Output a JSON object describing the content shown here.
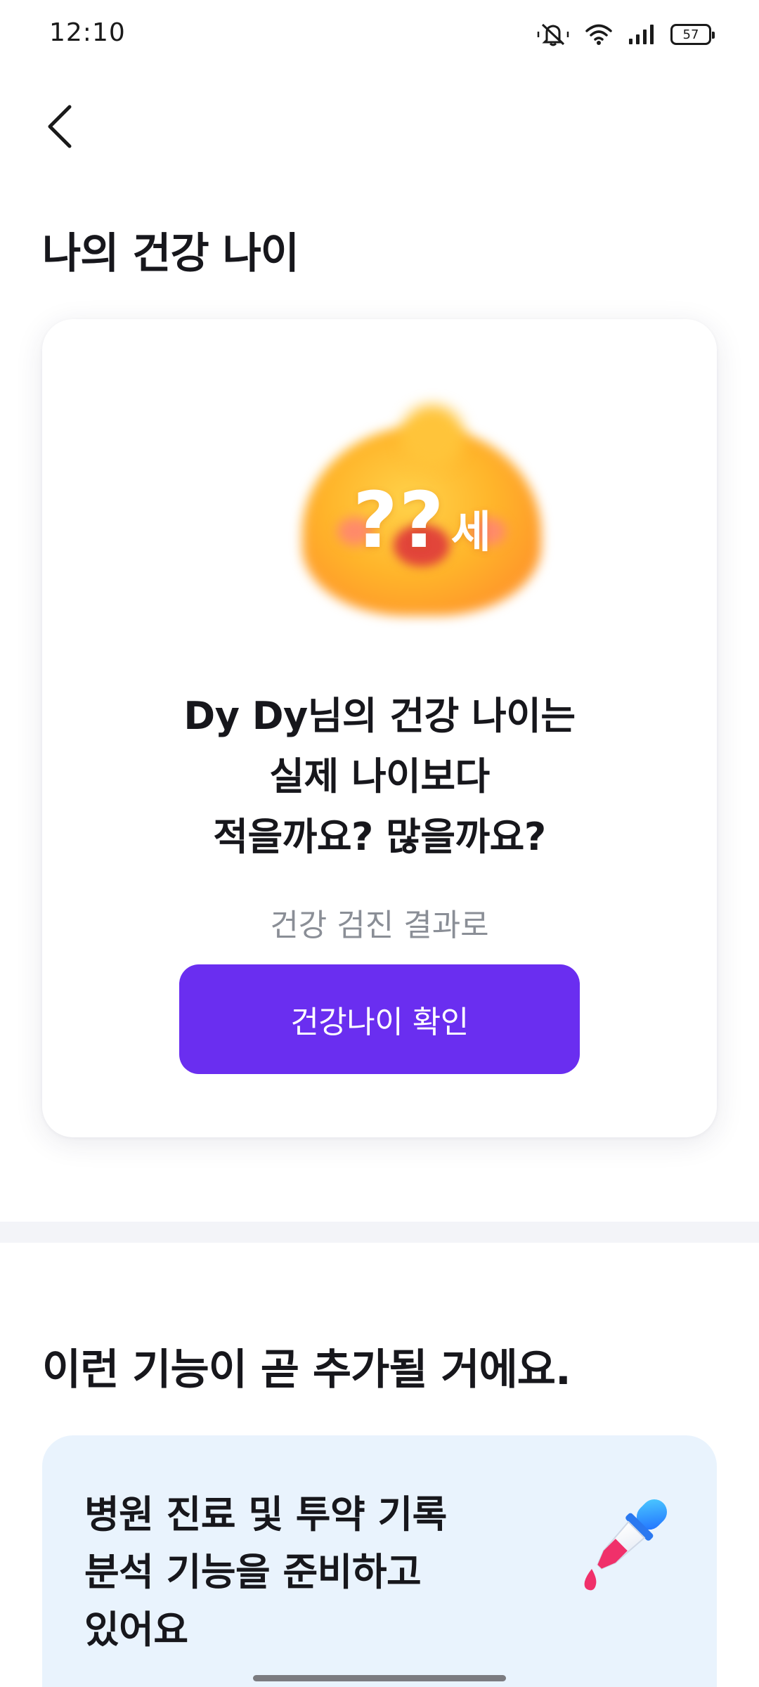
{
  "status_bar": {
    "time": "12:10",
    "battery": "57",
    "icons": [
      "mute-icon",
      "wifi-icon",
      "signal-icon",
      "battery-icon"
    ]
  },
  "nav": {
    "back_icon": "chevron-left-icon"
  },
  "health_age": {
    "section_title": "나의 건강 나이",
    "age_placeholder": "??",
    "age_unit": "세",
    "question_lines": [
      "Dy Dy님의 건강 나이는",
      "실제 나이보다",
      "적을까요? 많을까요?"
    ],
    "subtitle": "건강 검진 결과로",
    "cta_label": "건강나이 확인"
  },
  "upcoming": {
    "section_title": "이런 기능이 곧 추가될 거에요.",
    "feature_lines": [
      "병원 진료 및 투약 기록",
      "분석 기능을 준비하고",
      "있어요"
    ],
    "feature_icon": "dropper-icon"
  },
  "colors": {
    "accent": "#6a2ef0",
    "feature_card_bg": "#e9f3fd",
    "subtitle_gray": "#8a8e96"
  }
}
